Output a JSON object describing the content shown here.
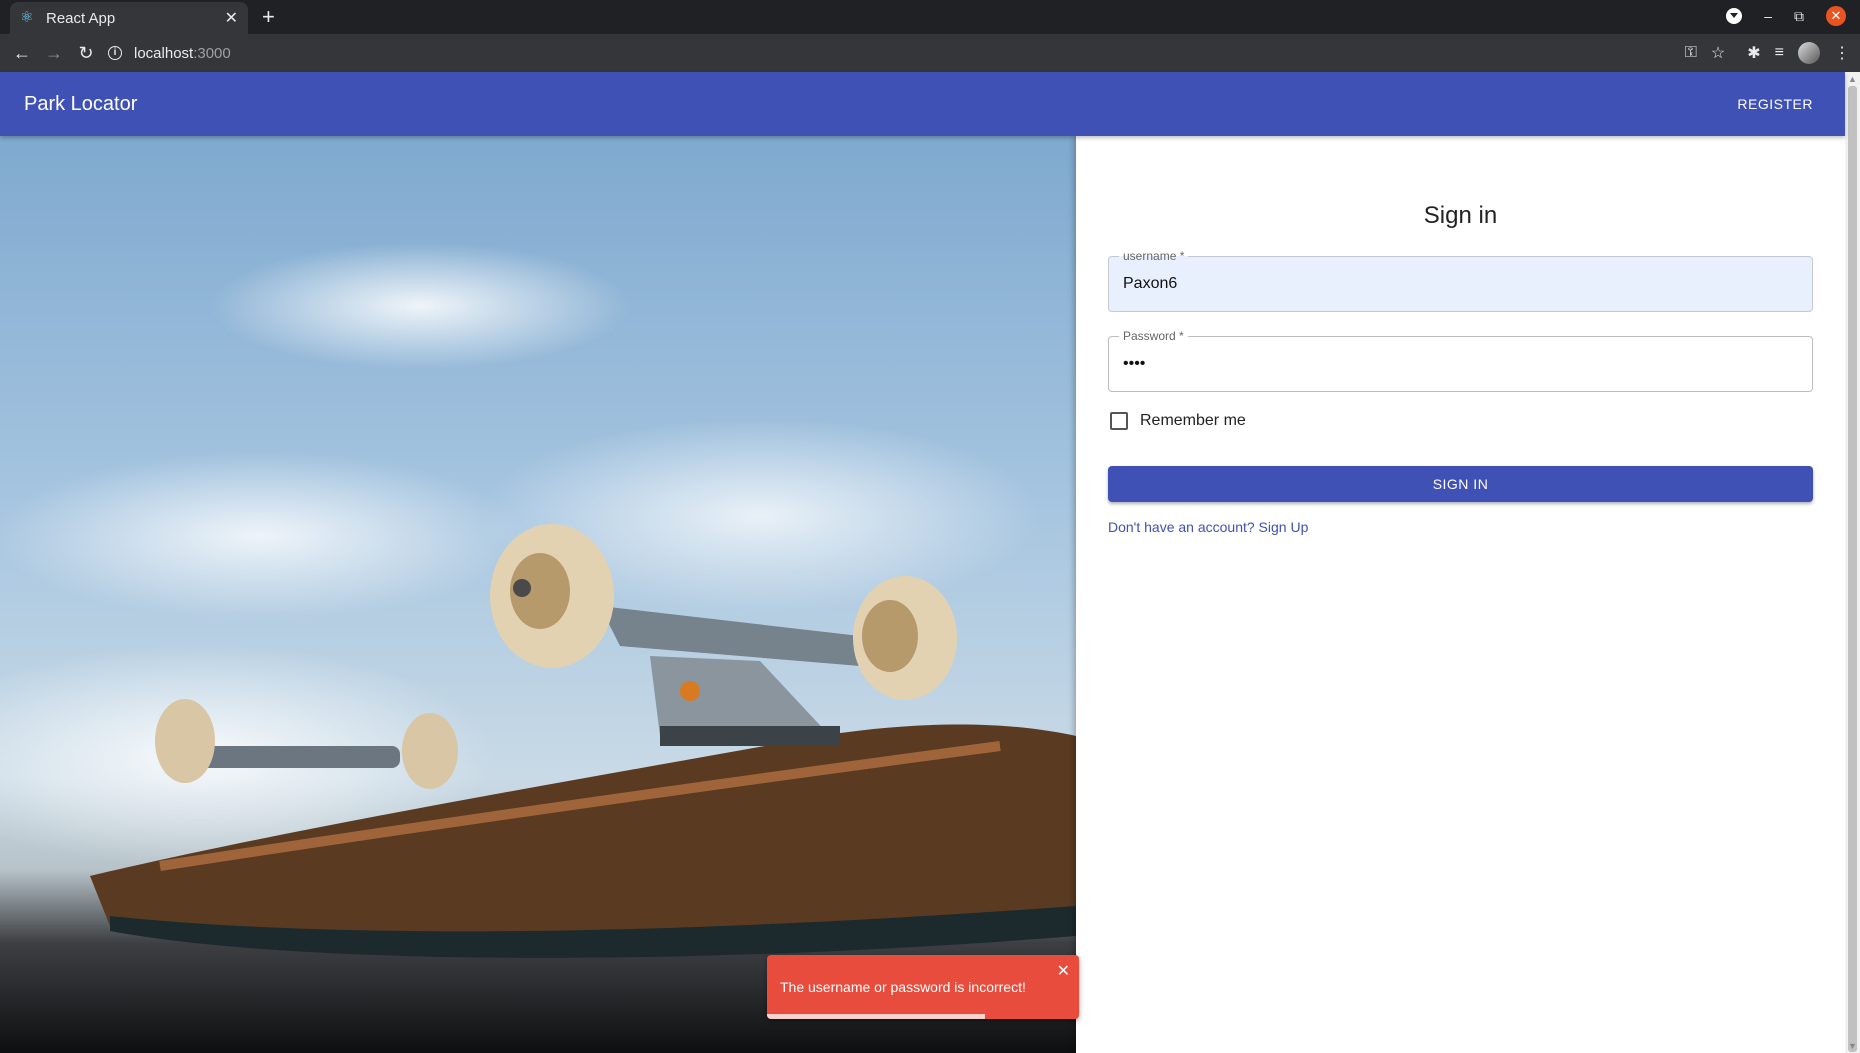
{
  "browser": {
    "tab_title": "React App",
    "tab_close": "✕",
    "new_tab": "+",
    "url_host": "localhost",
    "url_port": ":3000",
    "icons": [
      "back-icon",
      "forward-icon",
      "reload-icon",
      "info-icon",
      "key-icon",
      "star-icon",
      "extensions-icon",
      "media-icon",
      "profile-avatar",
      "menu-icon"
    ]
  },
  "appbar": {
    "title": "Park Locator",
    "register_label": "REGISTER",
    "color": "#3f51b5"
  },
  "signin": {
    "title": "Sign in",
    "username_label": "username *",
    "username_value": "Paxon6",
    "password_label": "Password *",
    "password_value": "••••",
    "remember_label": "Remember me",
    "remember_checked": false,
    "button_label": "SIGN IN",
    "signup_link": "Don't have an account? Sign Up"
  },
  "toast": {
    "message": "The username or password is incorrect!",
    "close": "✕",
    "color": "#e74c3c",
    "progress_fraction": 0.7
  }
}
